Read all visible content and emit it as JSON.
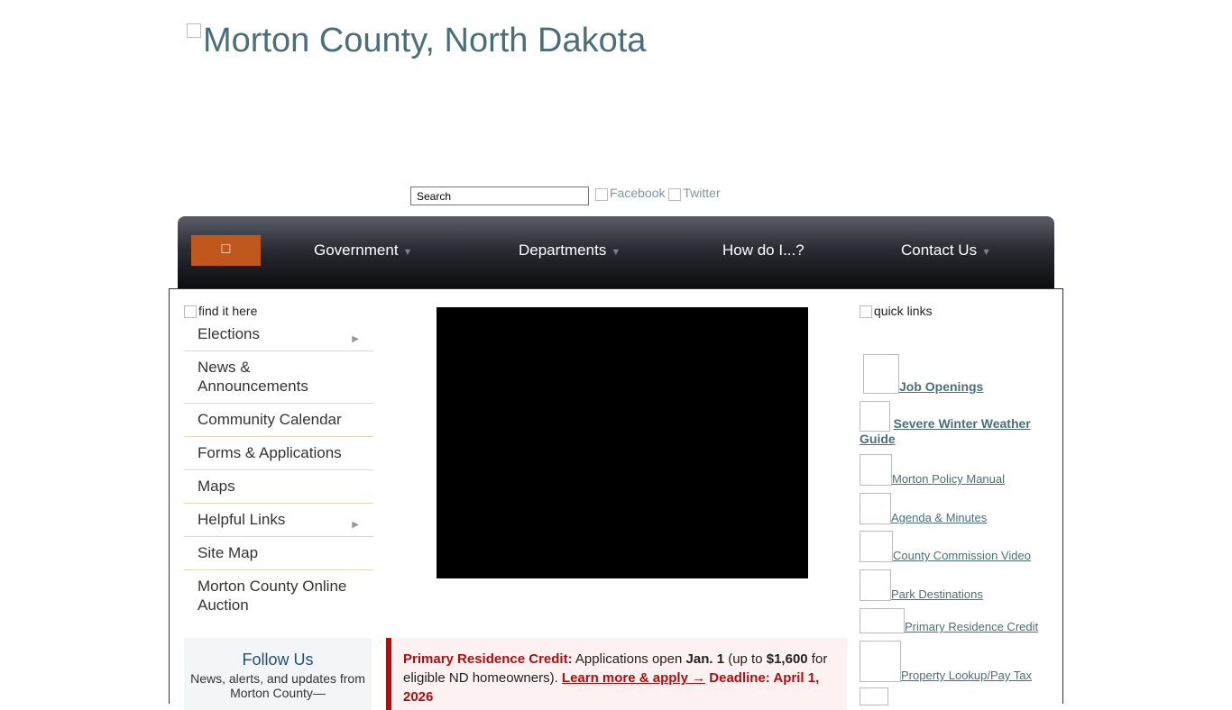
{
  "header": {
    "logo_alt": "Morton County, North Dakota"
  },
  "search": {
    "placeholder": "Search",
    "value": "Search"
  },
  "social": {
    "facebook": "Facebook",
    "twitter": "Twitter"
  },
  "nav": {
    "home_icon": "home-icon",
    "items": [
      {
        "label": "Government",
        "has_dropdown": true
      },
      {
        "label": "Departments",
        "has_dropdown": true
      },
      {
        "label": "How do I...?",
        "has_dropdown": false
      },
      {
        "label": "Contact Us",
        "has_dropdown": true
      }
    ],
    "dropdown_arrow": "▼"
  },
  "sidebar": {
    "heading_alt": "find it here",
    "items": [
      {
        "label": "Elections",
        "submenu": true
      },
      {
        "label": "News & Announcements",
        "submenu": false
      },
      {
        "label": "Community Calendar",
        "submenu": false
      },
      {
        "label": "Forms & Applications",
        "submenu": false
      },
      {
        "label": "Maps",
        "submenu": false
      },
      {
        "label": "Helpful Links",
        "submenu": true
      },
      {
        "label": "Site Map",
        "submenu": false
      },
      {
        "label": "Morton County Online Auction",
        "submenu": false
      }
    ],
    "submenu_arrow": "▶"
  },
  "follow": {
    "title": "Follow Us",
    "text": "News, alerts, and updates from Morton County—"
  },
  "alert": {
    "label": "Primary Residence Credit:",
    "text1": " Applications open ",
    "date1": "Jan. 1",
    "text2": " (up to ",
    "amount": "$1,600",
    "text3": " for eligible ND homeowners). ",
    "link": "Learn more & apply →",
    "deadline": " Deadline: April 1, 2026"
  },
  "quick_links": {
    "heading_alt": "quick links",
    "items": [
      "Job Openings",
      "Severe Winter Weather Guide",
      "Morton Policy Manual",
      "Agenda & Minutes",
      "County Commission Video",
      "Park Destinations",
      "Primary Residence Credit",
      "Property Lookup/Pay Tax"
    ]
  },
  "colors": {
    "accent": "#c0571c",
    "link": "#4a6f79",
    "alert": "#b20d0d",
    "follow_title": "#234e82"
  }
}
